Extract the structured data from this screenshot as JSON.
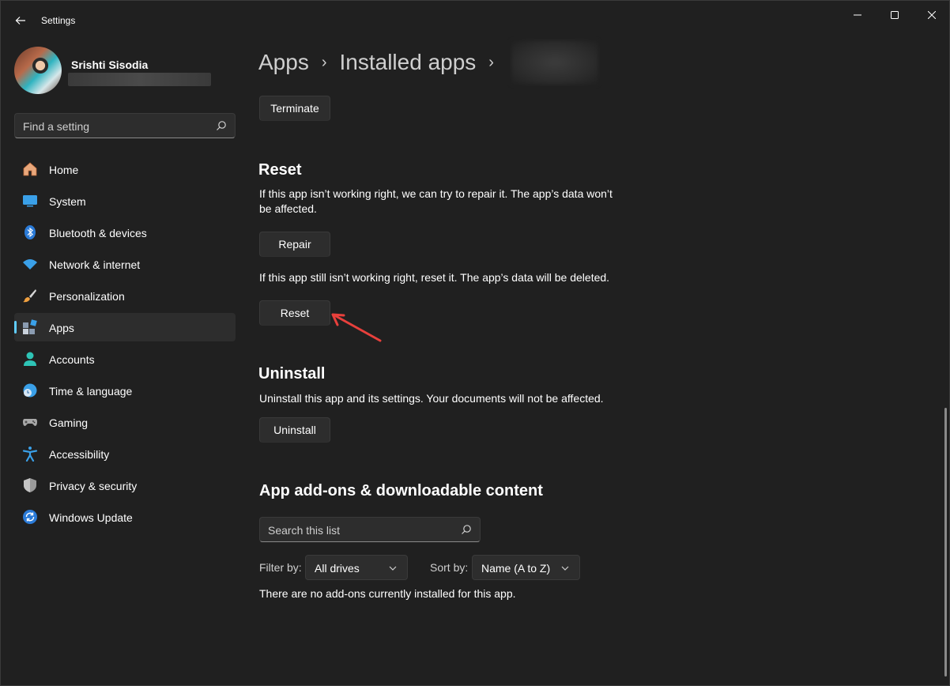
{
  "window": {
    "title": "Settings",
    "controls": {
      "minimize": "minimize",
      "maximize": "maximize",
      "close": "close"
    }
  },
  "profile": {
    "name": "Srishti Sisodia"
  },
  "search": {
    "placeholder": "Find a setting"
  },
  "sidebar": {
    "items": [
      {
        "label": "Home",
        "icon": "home-icon"
      },
      {
        "label": "System",
        "icon": "system-icon"
      },
      {
        "label": "Bluetooth & devices",
        "icon": "bluetooth-icon"
      },
      {
        "label": "Network & internet",
        "icon": "wifi-icon"
      },
      {
        "label": "Personalization",
        "icon": "brush-icon"
      },
      {
        "label": "Apps",
        "icon": "apps-icon",
        "active": true
      },
      {
        "label": "Accounts",
        "icon": "accounts-icon"
      },
      {
        "label": "Time & language",
        "icon": "globe-clock-icon"
      },
      {
        "label": "Gaming",
        "icon": "controller-icon"
      },
      {
        "label": "Accessibility",
        "icon": "accessibility-icon"
      },
      {
        "label": "Privacy & security",
        "icon": "shield-icon"
      },
      {
        "label": "Windows Update",
        "icon": "update-icon"
      }
    ]
  },
  "breadcrumb": {
    "level1": "Apps",
    "separator": "›",
    "level2": "Installed apps"
  },
  "main": {
    "terminate_label": "Terminate",
    "reset_section": {
      "title": "Reset",
      "repair_desc": "If this app isn’t working right, we can try to repair it. The app’s data won’t be affected.",
      "repair_label": "Repair",
      "reset_desc": "If this app still isn’t working right, reset it. The app’s data will be deleted.",
      "reset_label": "Reset"
    },
    "uninstall_section": {
      "title": "Uninstall",
      "desc": "Uninstall this app and its settings. Your documents will not be affected.",
      "uninstall_label": "Uninstall"
    },
    "addons_section": {
      "title": "App add-ons & downloadable content",
      "search_placeholder": "Search this list",
      "filter_label": "Filter by:",
      "filter_value": "All drives",
      "sort_label": "Sort by:",
      "sort_value": "Name (A to Z)",
      "empty_message": "There are no add-ons currently installed for this app."
    }
  },
  "colors": {
    "background": "#202020",
    "accent": "#60cdff",
    "annotation_arrow": "#e8403c"
  }
}
